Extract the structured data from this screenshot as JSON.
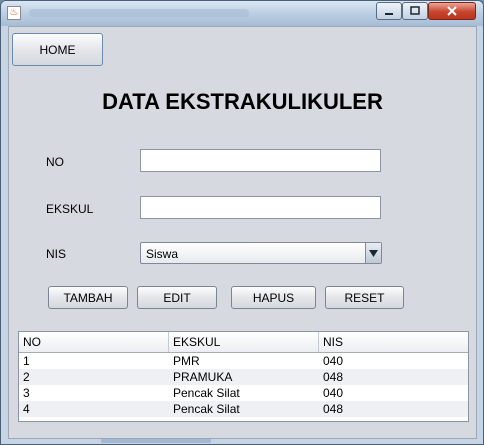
{
  "window": {
    "app_icon_glyph": "♨",
    "controls": {
      "minimize": "—",
      "maximize": "☐",
      "close": "✕"
    }
  },
  "home_button": "HOME",
  "heading": "DATA EKSTRAKULIKULER",
  "form": {
    "no_label": "NO",
    "no_value": "",
    "ekskul_label": "EKSKUL",
    "ekskul_value": "",
    "nis_label": "NIS",
    "nis_selected": "Siswa"
  },
  "actions": {
    "tambah": "TAMBAH",
    "edit": "EDIT",
    "hapus": "HAPUS",
    "reset": "RESET"
  },
  "table": {
    "headers": [
      "NO",
      "EKSKUL",
      "NIS"
    ],
    "rows": [
      [
        "1",
        "PMR",
        "040"
      ],
      [
        "2",
        "PRAMUKA",
        "048"
      ],
      [
        "3",
        "Pencak Silat",
        "040"
      ],
      [
        "4",
        "Pencak Silat",
        "048"
      ]
    ]
  }
}
